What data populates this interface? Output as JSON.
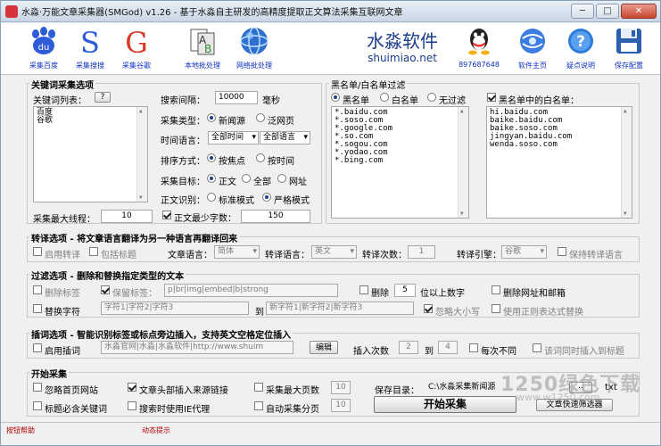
{
  "window": {
    "title": "水淼·万能文章采集器(SMGod) v1.26 - 基于水淼自主研发的高精度提取正文算法采集互联网文章",
    "minimize": "─",
    "maximize": "□",
    "close": "✕"
  },
  "toolbar": {
    "buttons": [
      {
        "label": "采集百度",
        "icon": "baidu-icon"
      },
      {
        "label": "采集搜搜",
        "icon": "soso-icon"
      },
      {
        "label": "采集谷歌",
        "icon": "google-icon"
      },
      {
        "label": "本地批处理",
        "icon": "local-batch-icon"
      },
      {
        "label": "网络批处理",
        "icon": "network-batch-icon"
      },
      {
        "label": "897687648",
        "icon": "qq-icon"
      },
      {
        "label": "软件主页",
        "icon": "homepage-icon"
      },
      {
        "label": "疑点说明",
        "icon": "help-icon"
      },
      {
        "label": "保存配置",
        "icon": "save-icon"
      }
    ],
    "brand_cn": "水淼软件",
    "brand_en": "shuimiao.net",
    "colors": {
      "brand": "#1a3c8c",
      "link": "#1030c0",
      "baidu_blue": "#2e5bd8",
      "google_red": "#d83a2a"
    }
  },
  "keyword": {
    "group_title": "关键词采集选项",
    "list_label": "关键词列表：",
    "list_btn": "?",
    "keywords": [
      "百度",
      "谷歌"
    ],
    "interval_label": "搜索间隔：",
    "interval_value": "10000",
    "interval_unit": "毫秒",
    "type_label": "采集类型：",
    "type_opts": [
      "新闻源",
      "泛网页"
    ],
    "time_lang_label": "时间语言：",
    "time_value": "全部时间",
    "lang_value": "全部语言",
    "sort_label": "排序方式：",
    "sort_opts": [
      "按焦点",
      "按时间"
    ],
    "target_label": "采集目标：",
    "target_opts": [
      "正文",
      "全部",
      "网址"
    ],
    "recog_label": "正文识别：",
    "recog_opts": [
      "标准模式",
      "严格模式"
    ],
    "threads_label": "采集最大线程：",
    "threads_value": "10",
    "minchars_label": "正文最少字数：",
    "minchars_value": "150"
  },
  "blacklist": {
    "group_title": "黑名单/白名单过滤",
    "mode_opts": [
      "黑名单",
      "白名单",
      "无过滤"
    ],
    "white_in_black_label": "黑名单中的白名单：",
    "black_items": [
      "*.baidu.com",
      "*.soso.com",
      "*.google.com",
      "*.so.com",
      "*.sogou.com",
      "*.yodao.com",
      "*.bing.com"
    ],
    "white_items": [
      "hi.baidu.com",
      "baike.baidu.com",
      "baike.soso.com",
      "jingyan.baidu.com",
      "wenda.soso.com"
    ]
  },
  "translate": {
    "title": "转译选项 - 将文章语言翻译为另一种语言再翻译回来",
    "enable_label": "启用转译",
    "include_title_label": "包括标题",
    "article_lang_label": "文章语言：",
    "article_lang_value": "简体",
    "trans_lang_label": "转译语言：",
    "trans_lang_value": "英文",
    "count_label": "转译次数：",
    "count_value": "1",
    "engine_label": "转译引擎：",
    "engine_value": "谷歌",
    "keep_lang_label": "保持转译语言"
  },
  "filter": {
    "title": "过滤选项 - 删除和替换指定类型的文本",
    "remove_tags_label": "删除标签",
    "keep_tags_label": "保留标签：",
    "keep_tags_value": "p|br|img|embed|b|strong",
    "delete_label": "删除",
    "delete_value": "5",
    "delete_suffix": "位以上数字",
    "remove_urls_label": "删除网址和邮箱",
    "replace_label": "替换字符",
    "replace_from": "字符1|字符2|字符3",
    "to_label": "到",
    "replace_to": "新字符1|新字符2|新字符3",
    "ignore_case_label": "忽略大小写",
    "regex_label": "使用正则表达式替换"
  },
  "insert": {
    "title": "插词选项 - 智能识别标签或标点旁边插入，支持英文空格定位插入",
    "enable_label": "启用插词",
    "words_value": "水淼官网|水淼|水淼软件|http://www.shuim",
    "edit_btn": "编辑",
    "count_label": "插入次数",
    "count_from": "2",
    "to_label": "到",
    "count_to": "4",
    "vary_label": "每次不同",
    "same_label": "该词同时插入到标题"
  },
  "start": {
    "title": "开始采集",
    "ignore_homepage_label": "忽略首页网站",
    "insert_source_label": "文章头部插入来源链接",
    "max_pages_label": "采集最大页数",
    "max_pages_value": "10",
    "title_keyword_label": "标题必含关键词",
    "ie_proxy_label": "搜索时使用IE代理",
    "auto_page_label": "自动采集分页",
    "auto_page_value": "10",
    "save_dir_label": "保存目录：",
    "save_dir_value": "C:\\水淼采集新闻源",
    "browse_btn": "..",
    "ext_value": "txt",
    "start_btn": "开始采集",
    "filter_btn": "文章快速筛选器"
  },
  "status": {
    "left": "按钮帮助",
    "right": "动态提示"
  },
  "watermark": {
    "line1": "1250绿色下载",
    "line2": "www.w1250.com"
  }
}
